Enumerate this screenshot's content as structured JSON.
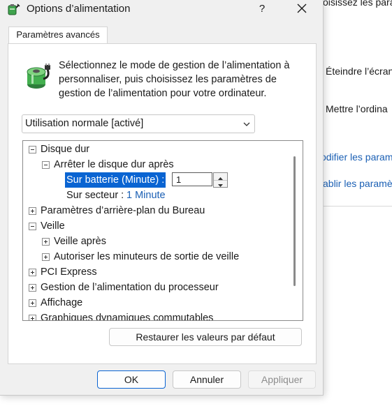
{
  "background": {
    "top_text": "oisissez les param",
    "turn_off_display": "Éteindre l’écran",
    "sleep": "Mettre l’ordina",
    "link_modify": "odifier les param",
    "link_restore": "ablir les paramè"
  },
  "dialog": {
    "title": "Options d’alimentation",
    "help": "?",
    "tab_label": "Paramètres avancés",
    "description": "Sélectionnez le mode de gestion de l’alimentation à personnaliser, puis choisissez les paramètres de gestion de l’alimentation pour votre ordinateur.",
    "plan_selected": "Utilisation normale [activé]",
    "tree": {
      "hdd": "Disque dur",
      "turn_off_hdd_after": "Arrêter le disque dur après",
      "on_battery_label": "Sur batterie (Minute) :",
      "on_battery_value": "1",
      "plugged_in_label": "Sur secteur :",
      "plugged_in_value": "1 Minute",
      "desktop_background": "Paramètres d’arrière-plan du Bureau",
      "sleep": "Veille",
      "sleep_after": "Veille après",
      "allow_wake_timers": "Autoriser les minuteurs de sortie de veille",
      "pci_express": "PCI Express",
      "processor": "Gestion de l’alimentation du processeur",
      "display": "Affichage",
      "switchable_graphics": "Graphiques dynamiques commutables"
    },
    "restore_defaults": "Restaurer les valeurs par défaut",
    "ok": "OK",
    "cancel": "Annuler",
    "apply": "Appliquer"
  },
  "icons": {
    "title_icon": "battery-plug-icon",
    "panel_icon": "battery-plug-icon",
    "close": "close-icon"
  },
  "colors": {
    "selection": "#0a64d2",
    "link": "#1a5fb4",
    "dialog_bg": "#f0f0f0"
  }
}
